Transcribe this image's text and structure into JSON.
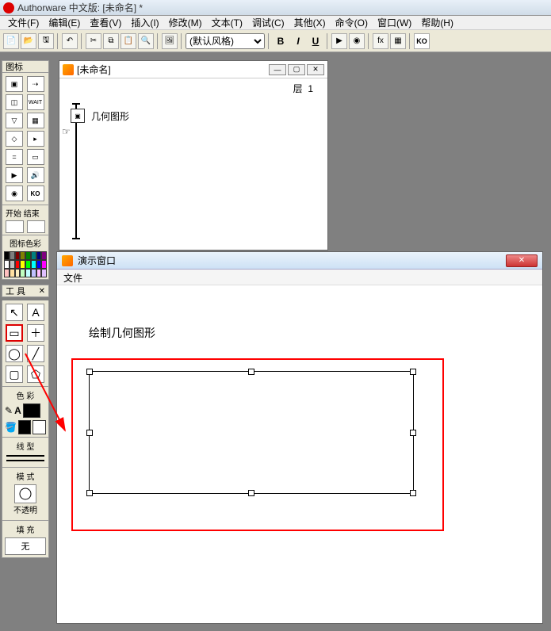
{
  "titlebar": {
    "text": "Authorware 中文版: [未命名] *"
  },
  "menu": {
    "file": "文件(F)",
    "edit": "编辑(E)",
    "view": "查看(V)",
    "insert": "插入(I)",
    "modify": "修改(M)",
    "text": "文本(T)",
    "debug": "调试(C)",
    "other": "其他(X)",
    "command": "命令(O)",
    "window": "窗口(W)",
    "help": "帮助(H)"
  },
  "toolbar": {
    "style_select": "(默认风格)"
  },
  "panels": {
    "icon_header": "图标",
    "startend": "开始 结束",
    "icon_color": "图标色彩",
    "tool_header": "工 具",
    "color": "色 彩",
    "line": "线 型",
    "mode": "模 式",
    "mode_label": "不透明",
    "fill": "填 充",
    "fill_label": "无"
  },
  "flowline": {
    "title": "[未命名]",
    "layer_label": "层",
    "layer_value": "1",
    "node_label": "几何图形"
  },
  "presentation": {
    "title": "演示窗口",
    "menu_file": "文件",
    "canvas_title": "绘制几何图形"
  },
  "colors": {
    "row1": [
      "#000000",
      "#7f7f7f",
      "#800000",
      "#808000",
      "#008000",
      "#008080",
      "#000080",
      "#800080"
    ],
    "row2": [
      "#ffffff",
      "#c0c0c0",
      "#ff0000",
      "#ffff00",
      "#00ff00",
      "#00ffff",
      "#0000ff",
      "#ff00ff"
    ],
    "row3": [
      "#ffc0c0",
      "#ffe0a0",
      "#fff0c0",
      "#c0ffc0",
      "#c0ffff",
      "#c0c0ff",
      "#ffc0ff",
      "#e0c0ff"
    ]
  }
}
